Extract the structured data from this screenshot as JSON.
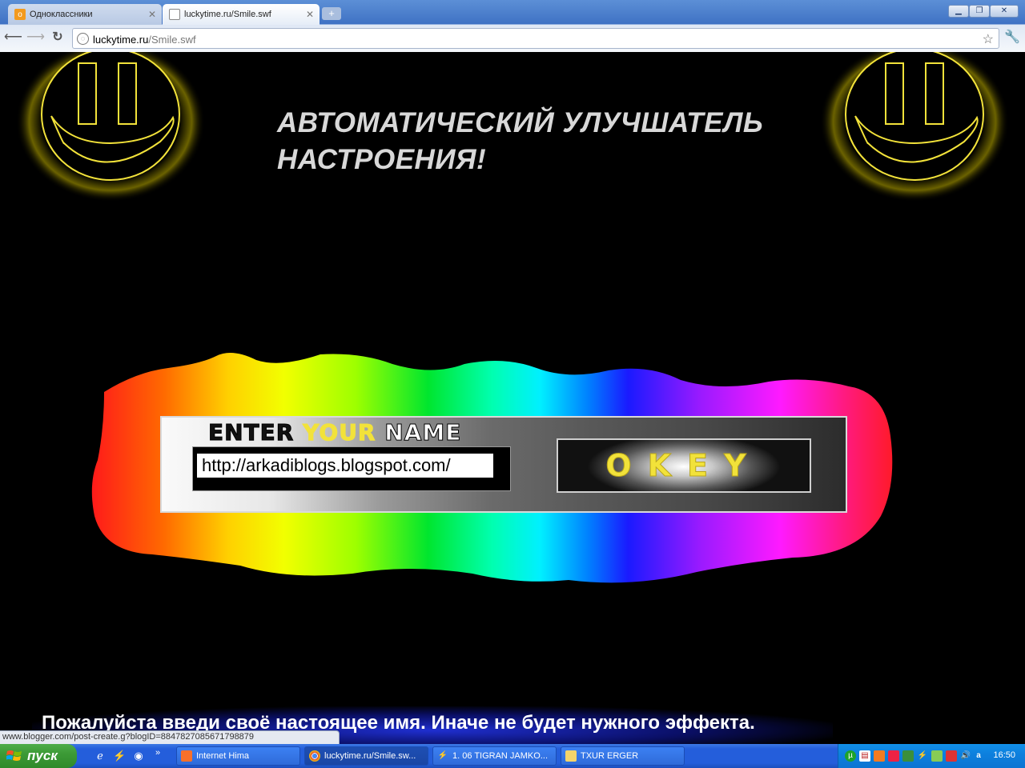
{
  "browser": {
    "tabs": [
      {
        "title": "Одноклассники",
        "icon": "odnoklassniki-icon",
        "active": false
      },
      {
        "title": "luckytime.ru/Smile.swf",
        "icon": "page-icon",
        "active": true
      }
    ],
    "url_host": "luckytime.ru",
    "url_path": "/Smile.swf"
  },
  "page": {
    "headline_line1": "АВТОМАТИЧЕСКИЙ УЛУЧШАТЕЛЬ",
    "headline_line2": "НАСТРОЕНИЯ!",
    "enter_word1": "ENTER",
    "enter_word2": "YOUR",
    "enter_word3": "NAME",
    "name_value": "http://arkadiblogs.blogspot.com/",
    "okey_label": "OKEY",
    "bottom_message": "Пожалуйста введи своё настоящее имя. Иначе не будет нужного эффекта.",
    "status_url": "www.blogger.com/post-create.g?blogID=8847827085671798879",
    "colors": {
      "smiley": "#f2e23a",
      "okey_text": "#f2e23a",
      "headline": "#d8d8d8"
    }
  },
  "taskbar": {
    "start_label": "пуск",
    "quick_launch": [
      "ie-icon",
      "winamp-icon",
      "chrome-icon"
    ],
    "quick_more": "»",
    "tasks": [
      {
        "label": "Internet Hima",
        "icon": "hima-icon",
        "active": false
      },
      {
        "label": "luckytime.ru/Smile.sw...",
        "icon": "chrome-icon",
        "active": true
      },
      {
        "label": "1. 06 TIGRAN JAMKO...",
        "icon": "winamp-icon",
        "active": false
      },
      {
        "label": "TXUR ERGER",
        "icon": "folder-icon",
        "active": false
      }
    ],
    "clock": "16:50"
  }
}
